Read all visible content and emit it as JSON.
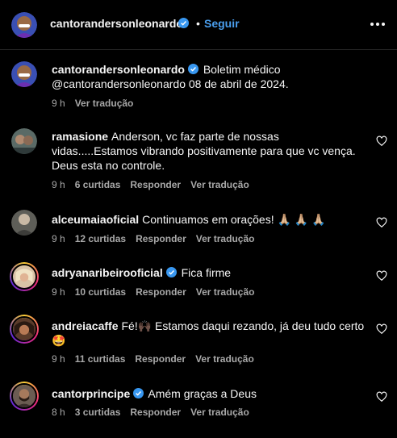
{
  "header": {
    "username": "cantorandersonleonardo",
    "separator": "•",
    "follow_label": "Seguir"
  },
  "caption": {
    "username": "cantorandersonleonardo",
    "text": "Boletim médico @cantorandersonleonardo 08 de abril de 2024.",
    "time": "9 h",
    "translate": "Ver tradução"
  },
  "comments": [
    {
      "username": "ramasione",
      "text": "Anderson, vc faz parte de nossas vidas.....Estamos vibrando positivamente para que vc vença. Deus esta no controle.",
      "time": "9 h",
      "likes": "6 curtidas",
      "reply": "Responder",
      "translate": "Ver tradução"
    },
    {
      "username": "alceumaiaoficial",
      "text": "Continuamos em orações! 🙏🏼 🙏🏼 🙏🏼",
      "time": "9 h",
      "likes": "12 curtidas",
      "reply": "Responder",
      "translate": "Ver tradução"
    },
    {
      "username": "adryanaribeirooficial",
      "text": "Fica firme",
      "time": "9 h",
      "likes": "10 curtidas",
      "reply": "Responder",
      "translate": "Ver tradução"
    },
    {
      "username": "andreiacaffe",
      "text": "Fé!🙌🏿 Estamos daqui rezando, já deu tudo certo 🤩",
      "time": "9 h",
      "likes": "11 curtidas",
      "reply": "Responder",
      "translate": "Ver tradução"
    },
    {
      "username": "cantorprincipe",
      "text": "Amém graças a Deus",
      "time": "8 h",
      "likes": "3 curtidas",
      "reply": "Responder",
      "translate": "Ver tradução"
    }
  ],
  "colors": {
    "background": "#000000",
    "link": "#4a9eed",
    "verified": "#3897f0",
    "muted": "#a8a8a8"
  }
}
